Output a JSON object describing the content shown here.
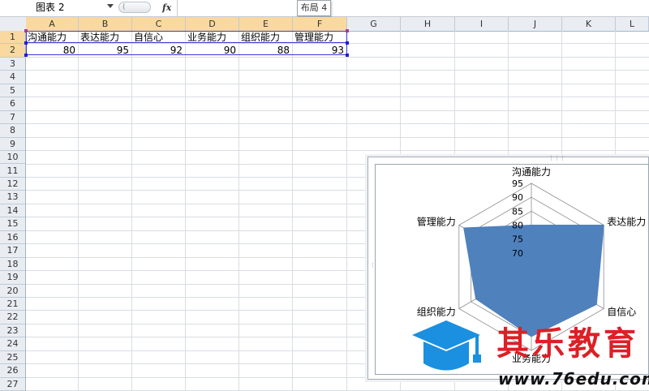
{
  "formula_bar": {
    "name_box": "图表 2",
    "fx_label": "fx",
    "tooltip": "布局 4"
  },
  "columns": [
    "A",
    "B",
    "C",
    "D",
    "E",
    "F",
    "G",
    "H",
    "I",
    "J",
    "K",
    "L"
  ],
  "rows": [
    "1",
    "2",
    "3",
    "4",
    "5",
    "6",
    "7",
    "8",
    "9",
    "10",
    "11",
    "12",
    "13",
    "14",
    "15",
    "16",
    "17",
    "18",
    "19",
    "20",
    "21",
    "22",
    "23",
    "24",
    "25",
    "26",
    "27"
  ],
  "sheet": {
    "row1": [
      "沟通能力",
      "表达能力",
      "自信心",
      "业务能力",
      "组织能力",
      "管理能力"
    ],
    "row2": [
      "80",
      "95",
      "92",
      "90",
      "88",
      "93"
    ]
  },
  "chart_data": {
    "type": "radar",
    "categories": [
      "沟通能力",
      "表达能力",
      "自信心",
      "业务能力",
      "组织能力",
      "管理能力"
    ],
    "series": [
      {
        "values": [
          80,
          95,
          92,
          90,
          88,
          93
        ],
        "color": "#4f81bd"
      }
    ],
    "rlim": [
      65,
      95
    ],
    "ticks": [
      "70",
      "75",
      "80",
      "85",
      "90",
      "95"
    ],
    "grid": true
  },
  "watermark": {
    "title": "其乐教育",
    "url": "www.76edu.com",
    "brand_color": "#dd1f26",
    "logo_color": "#1b8fe0"
  }
}
